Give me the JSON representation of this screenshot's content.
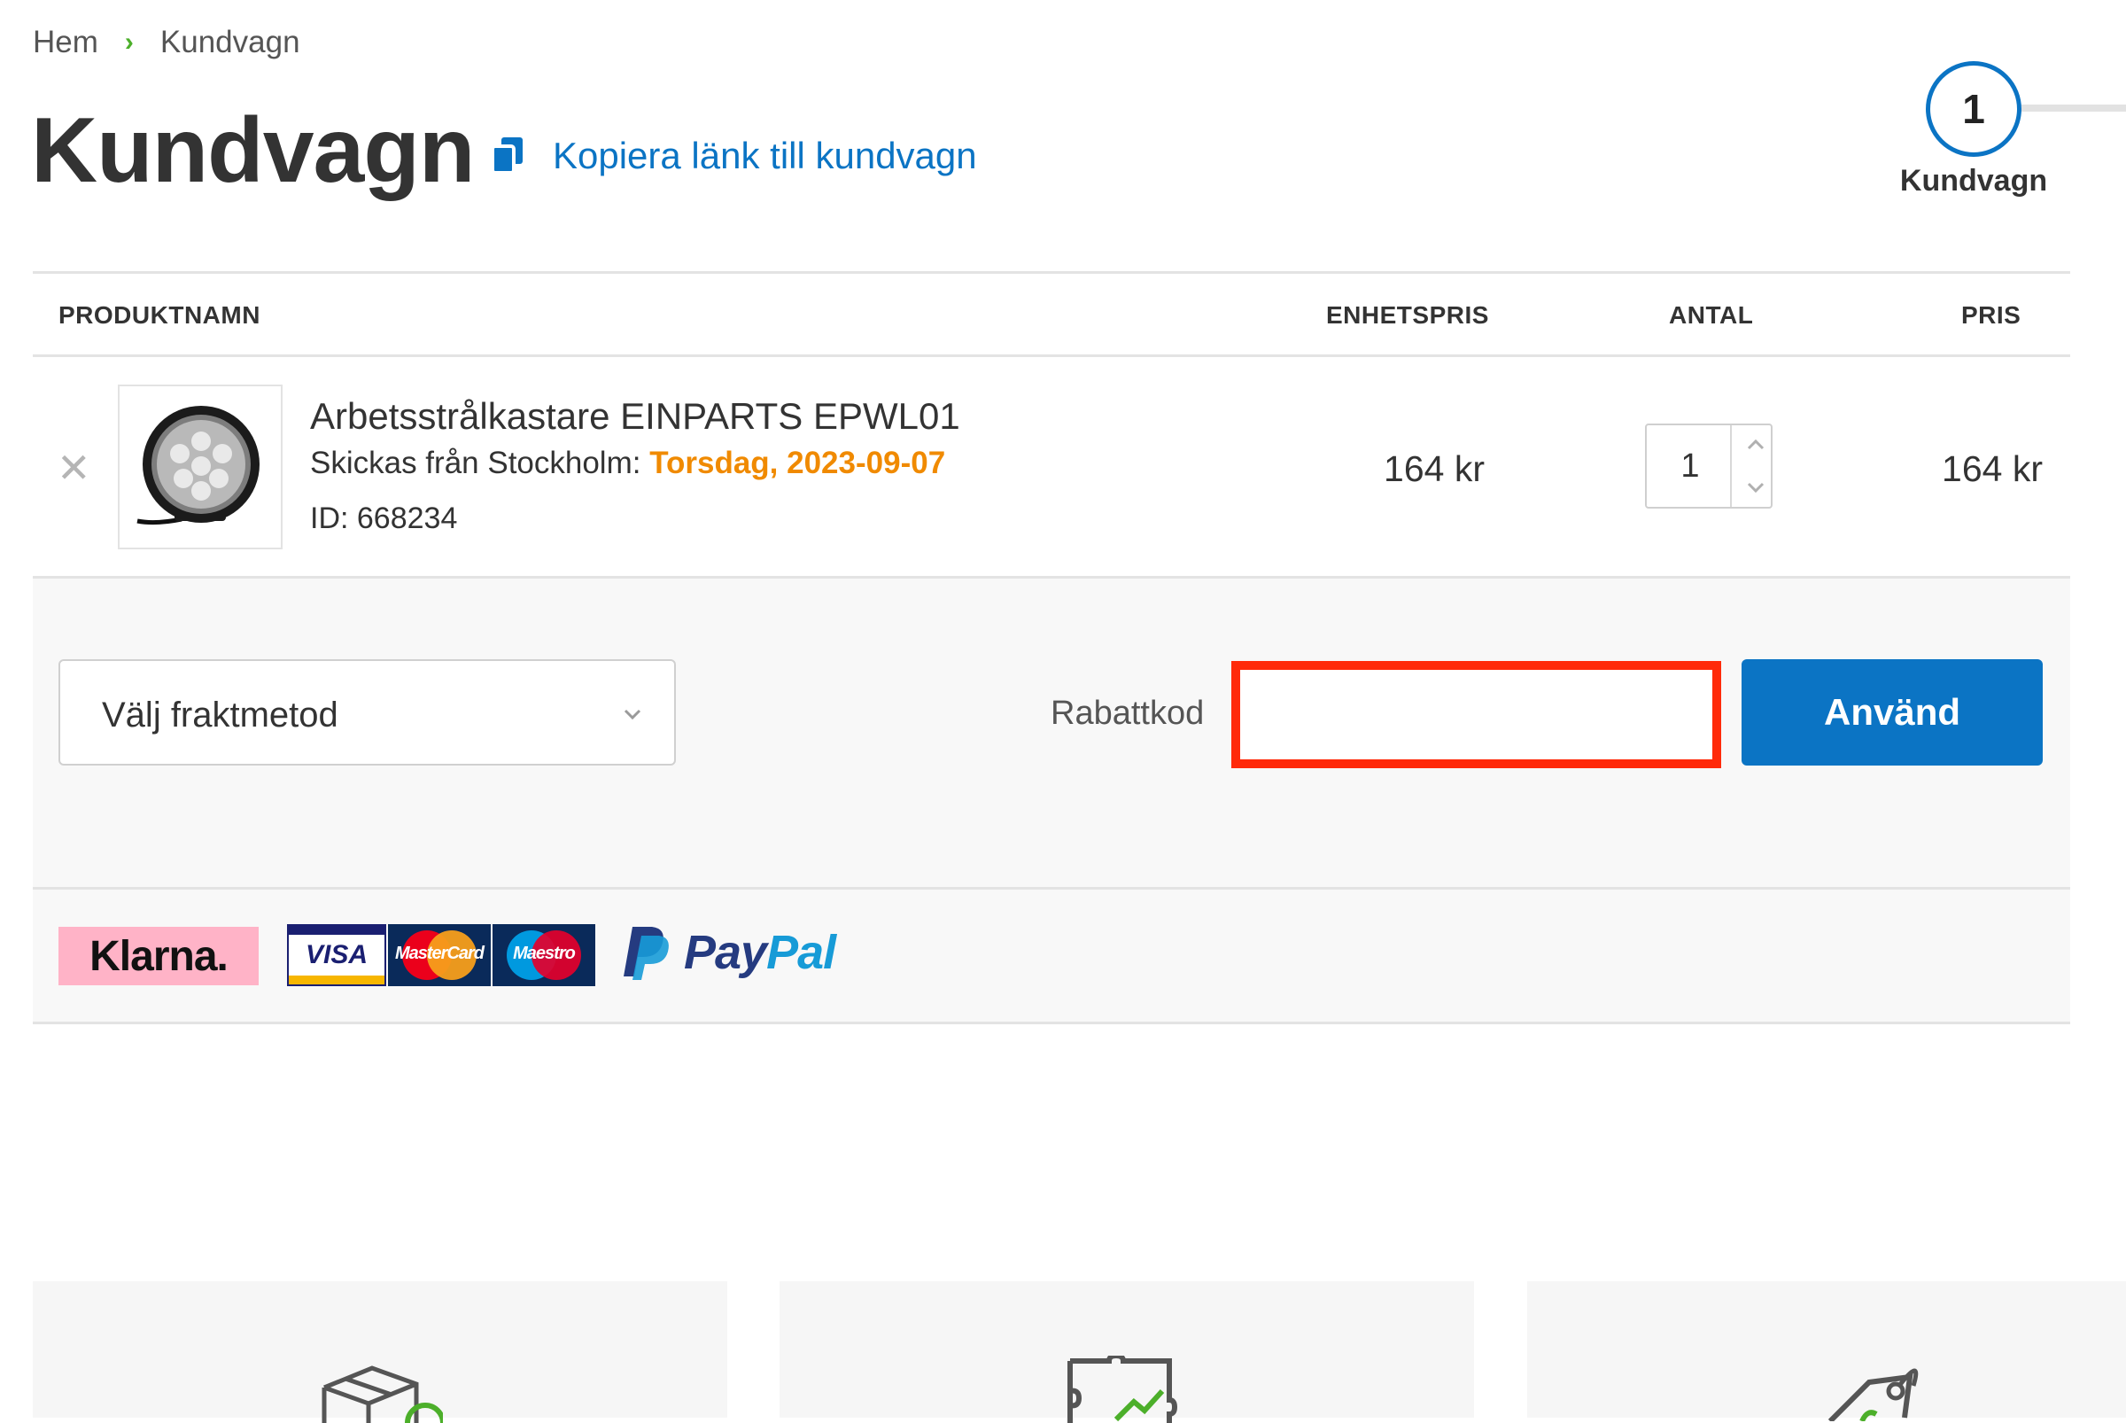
{
  "breadcrumb": {
    "home": "Hem",
    "current": "Kundvagn"
  },
  "page": {
    "title": "Kundvagn",
    "copy_link": "Kopiera länk till kundvagn"
  },
  "steps": [
    {
      "number": "1",
      "label": "Kundvagn"
    }
  ],
  "table": {
    "headers": {
      "product": "PRODUKTNAMN",
      "unit_price": "ENHETSPRIS",
      "quantity": "ANTAL",
      "price": "PRIS"
    },
    "items": [
      {
        "name": "Arbetsstrålkastare EINPARTS EPWL01",
        "ship_prefix": "Skickas från Stockholm:",
        "ship_date": "Torsdag, 2023-09-07",
        "id": "ID: 668234",
        "unit_price": "164 kr",
        "quantity": "1",
        "price": "164 kr",
        "remove": "✕"
      }
    ]
  },
  "shipping": {
    "placeholder": "Välj fraktmetod"
  },
  "discount": {
    "label": "Rabattkod",
    "value": "",
    "apply": "Använd"
  },
  "payment_logos": {
    "klarna": "Klarna.",
    "visa": "VISA",
    "mastercard": "MasterCard",
    "maestro": "Maestro",
    "paypal_pay": "Pay",
    "paypal_pal": "Pal"
  },
  "colors": {
    "accent_blue": "#0b74c4",
    "date_orange": "#f08a00",
    "breadcrumb_green": "#4caf2a",
    "highlight_red": "#ff2a0a",
    "klarna_pink": "#ffb3c7"
  },
  "icons": {
    "copy": "copy-icon",
    "remove": "close-icon",
    "select": "chevron-down-icon",
    "qty_up": "chevron-up-icon",
    "qty_down": "chevron-down-icon",
    "features": [
      "package-icon",
      "puzzle-icon",
      "tag-icon"
    ]
  }
}
